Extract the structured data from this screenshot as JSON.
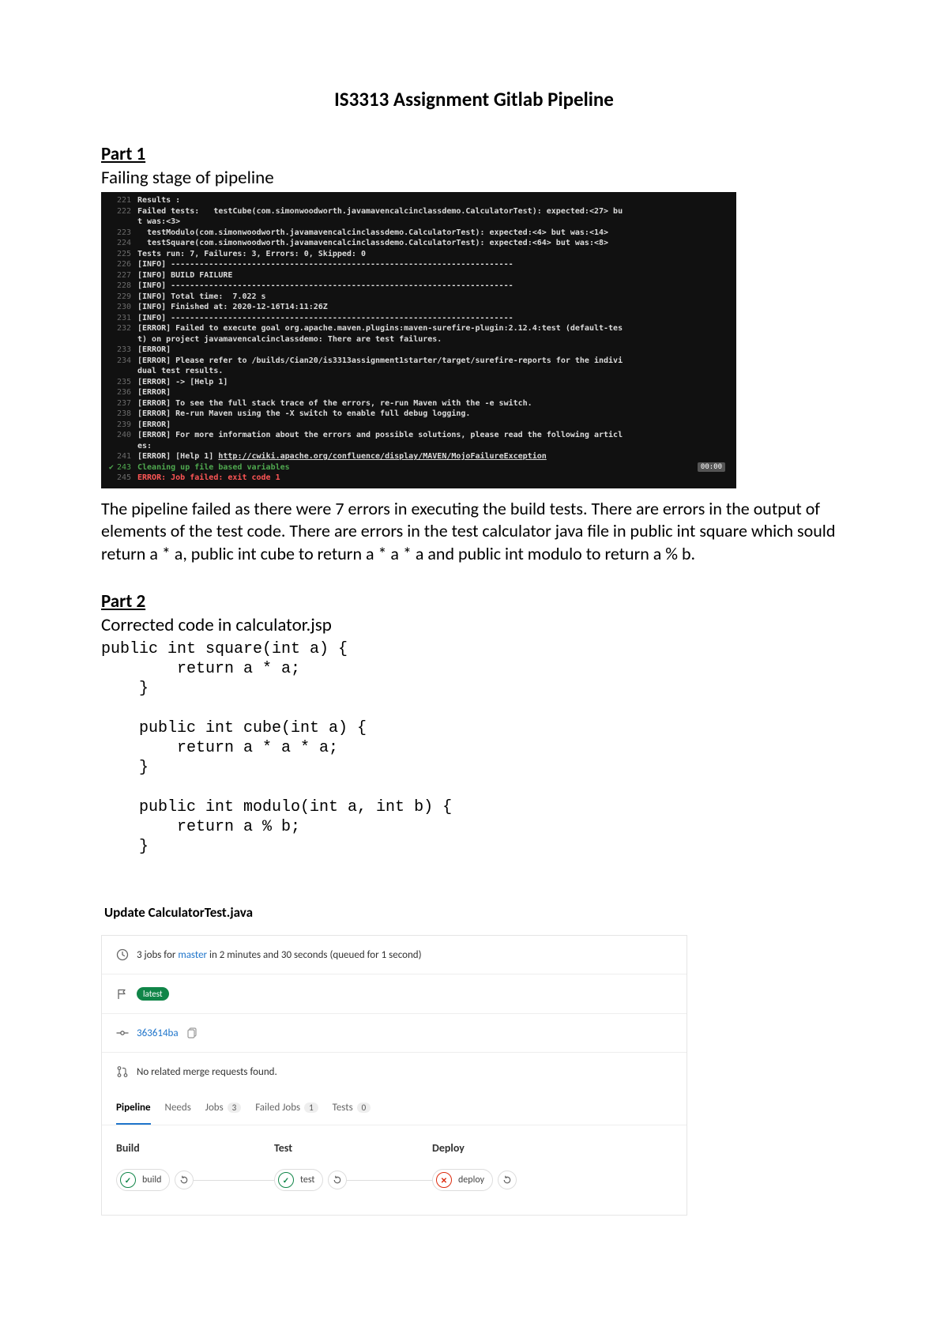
{
  "title": "IS3313 Assignment Gitlab Pipeline",
  "part1": {
    "heading": "Part 1",
    "subheading": "Failing stage of pipeline",
    "paragraph": "The pipeline failed as there were 7 errors in executing the build tests. There are errors in the output of elements of the test code. There are errors in the test calculator java file in public int square which sould return a * a, public int cube to return a * a * a and public int modulo to return a % b."
  },
  "terminal": {
    "timer": "00:00",
    "lines": [
      {
        "n": 221,
        "t": "Results :"
      },
      {
        "n": 222,
        "t": "Failed tests:   testCube(com.simonwoodworth.javamavencalcinclassdemo.CalculatorTest): expected:<27> bu"
      },
      {
        "n": "",
        "t": "t was:<3>",
        "indent": true
      },
      {
        "n": 223,
        "t": "  testModulo(com.simonwoodworth.javamavencalcinclassdemo.CalculatorTest): expected:<4> but was:<14>"
      },
      {
        "n": 224,
        "t": "  testSquare(com.simonwoodworth.javamavencalcinclassdemo.CalculatorTest): expected:<64> but was:<8>"
      },
      {
        "n": 225,
        "t": "Tests run: 7, Failures: 3, Errors: 0, Skipped: 0"
      },
      {
        "n": 226,
        "t": "[INFO] ------------------------------------------------------------------------"
      },
      {
        "n": 227,
        "t": "[INFO] BUILD FAILURE"
      },
      {
        "n": 228,
        "t": "[INFO] ------------------------------------------------------------------------"
      },
      {
        "n": 229,
        "t": "[INFO] Total time:  7.022 s"
      },
      {
        "n": 230,
        "t": "[INFO] Finished at: 2020-12-16T14:11:26Z"
      },
      {
        "n": 231,
        "t": "[INFO] ------------------------------------------------------------------------"
      },
      {
        "n": 232,
        "t": "[ERROR] Failed to execute goal org.apache.maven.plugins:maven-surefire-plugin:2.12.4:test (default-tes"
      },
      {
        "n": "",
        "t": "t) on project javamavencalcinclassdemo: There are test failures.",
        "indent": true
      },
      {
        "n": 233,
        "t": "[ERROR]"
      },
      {
        "n": 234,
        "t": "[ERROR] Please refer to /builds/Cian20/is3313assignment1starter/target/surefire-reports for the indivi"
      },
      {
        "n": "",
        "t": "dual test results.",
        "indent": true
      },
      {
        "n": 235,
        "t": "[ERROR] -> [Help 1]"
      },
      {
        "n": 236,
        "t": "[ERROR]"
      },
      {
        "n": 237,
        "t": "[ERROR] To see the full stack trace of the errors, re-run Maven with the -e switch."
      },
      {
        "n": 238,
        "t": "[ERROR] Re-run Maven using the -X switch to enable full debug logging."
      },
      {
        "n": 239,
        "t": "[ERROR]"
      },
      {
        "n": 240,
        "t": "[ERROR] For more information about the errors and possible solutions, please read the following articl"
      },
      {
        "n": "",
        "t": "es:",
        "indent": true
      },
      {
        "n": 241,
        "t": "[ERROR] [Help 1] ",
        "link": "http://cwiki.apache.org/confluence/display/MAVEN/MojoFailureException"
      },
      {
        "n": 243,
        "t": "Cleaning up file based variables",
        "caret": true,
        "green": true,
        "timer": true
      },
      {
        "n": 245,
        "t": "ERROR: Job failed: exit code 1",
        "red": true
      }
    ]
  },
  "part2": {
    "heading": "Part 2",
    "subheading": "Corrected code in calculator.jsp",
    "code": "public int square(int a) {\n        return a * a;\n    }\n\n    public int cube(int a) {\n        return a * a * a;\n    }\n\n    public int modulo(int a, int b) {\n        return a % b;\n    }"
  },
  "gitlab": {
    "card_title": "Update CalculatorTest.java",
    "clock_text_prefix": "3 jobs for ",
    "branch": "master",
    "clock_text_suffix": " in 2 minutes and 30 seconds (queued for 1 second)",
    "latest_label": "latest",
    "commit": "363614ba",
    "mr_text": "No related merge requests found.",
    "tabs": {
      "pipeline": "Pipeline",
      "needs": "Needs",
      "jobs": "Jobs",
      "jobs_count": "3",
      "failed": "Failed Jobs",
      "failed_count": "1",
      "tests": "Tests",
      "tests_count": "0"
    },
    "stages": [
      {
        "name": "Build",
        "job": "build",
        "status": "pass"
      },
      {
        "name": "Test",
        "job": "test",
        "status": "pass"
      },
      {
        "name": "Deploy",
        "job": "deploy",
        "status": "fail"
      }
    ]
  }
}
